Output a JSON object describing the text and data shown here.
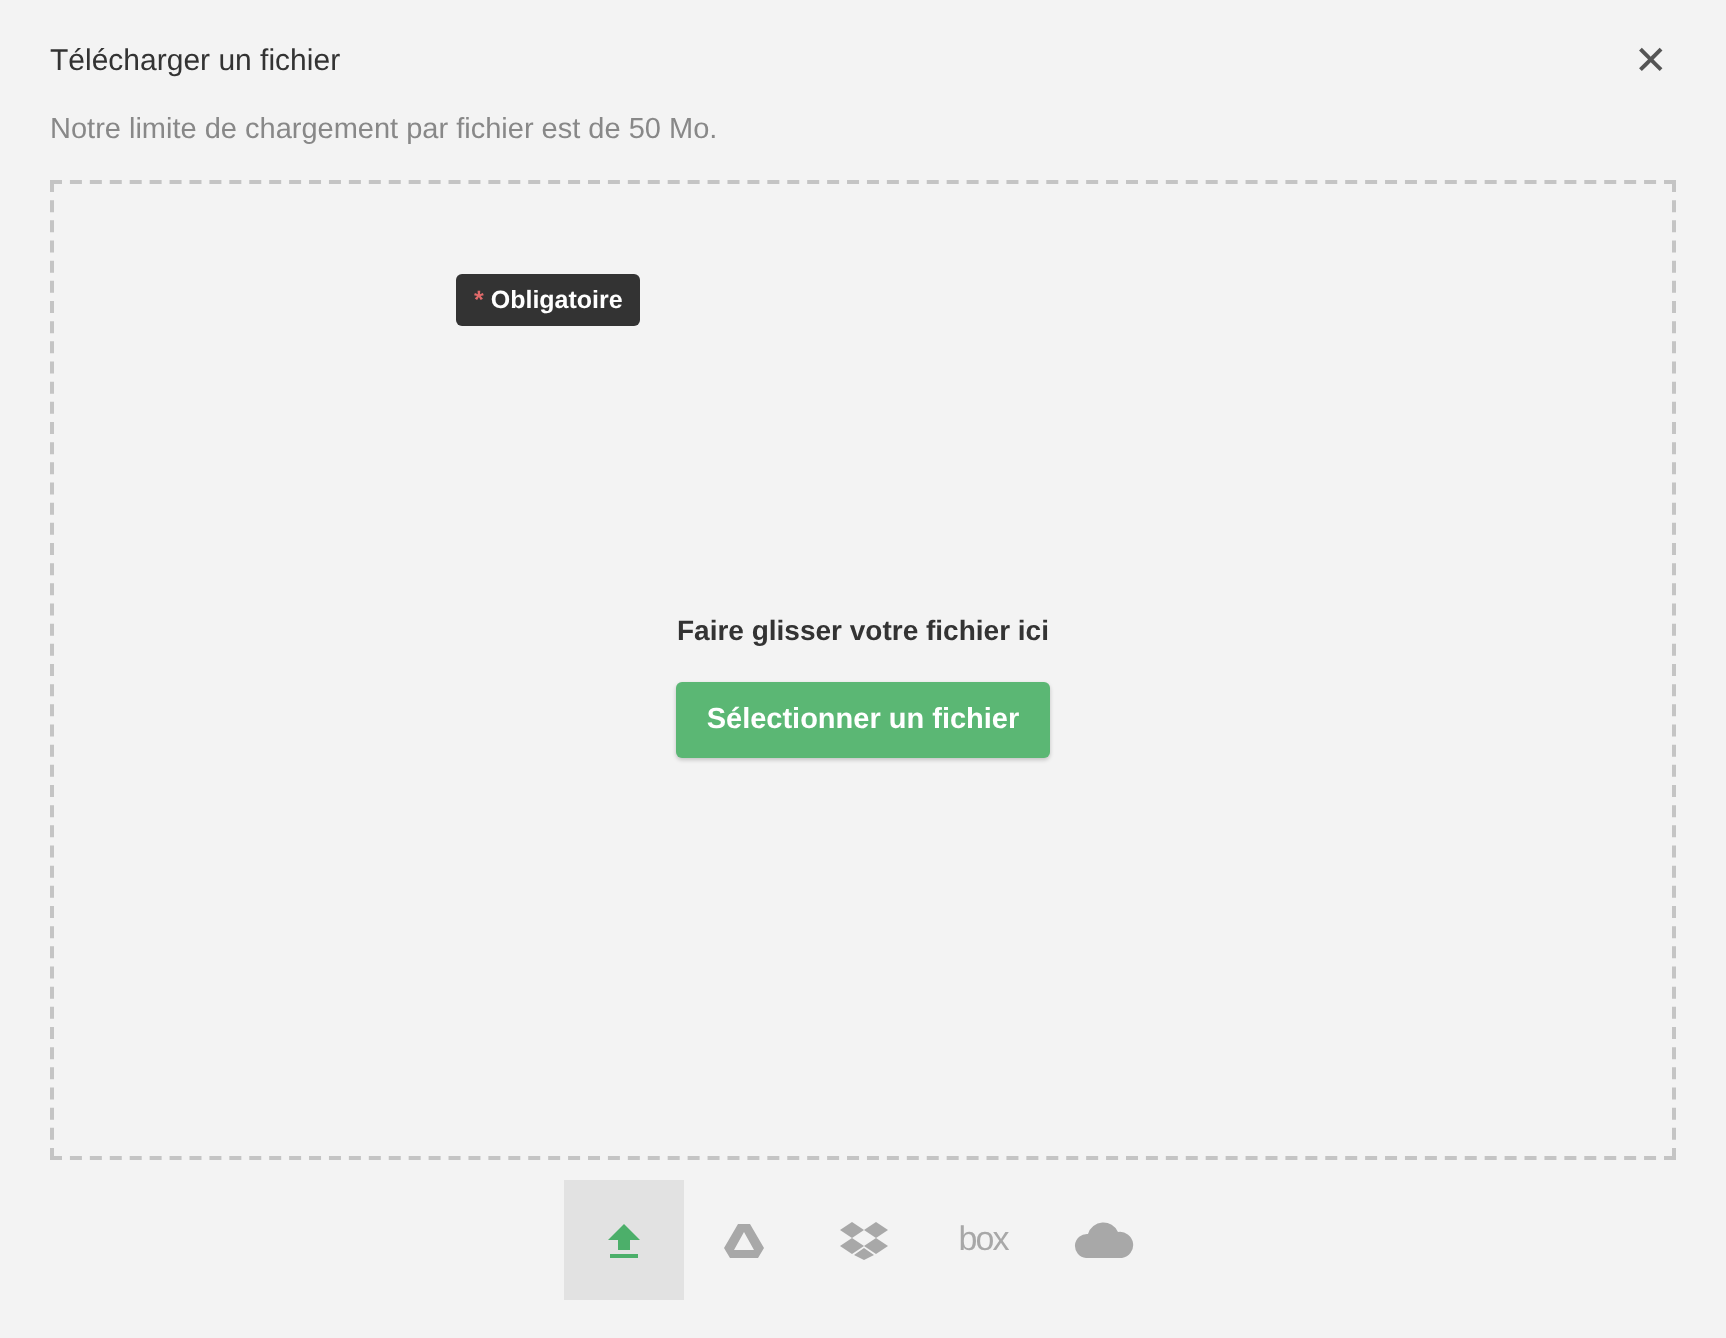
{
  "dialog": {
    "title": "Télécharger un fichier",
    "close": "✕",
    "subtitle": "Notre limite de chargement par fichier est de 50 Mo."
  },
  "dropzone": {
    "tooltip": {
      "asterisk": "*",
      "text": "Obligatoire"
    },
    "prompt": "Faire glisser votre fichier ici",
    "button": "Sélectionner un fichier"
  },
  "sources": [
    {
      "kind": "upload",
      "selected": true
    },
    {
      "kind": "drive",
      "selected": false
    },
    {
      "kind": "dropbox",
      "selected": false
    },
    {
      "kind": "box",
      "label": "box",
      "selected": false
    },
    {
      "kind": "cloud",
      "selected": false
    }
  ]
}
